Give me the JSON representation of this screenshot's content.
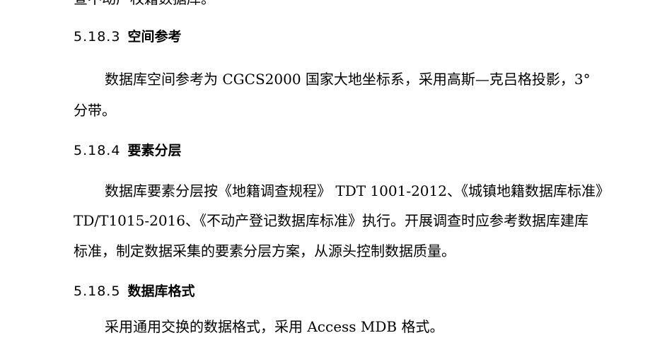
{
  "cut_line": "查不动产权籍数据库。",
  "sections": [
    {
      "number": "5.18.3",
      "title": "空间参考",
      "lines": [
        "数据库空间参考为 CGCS2000 国家大地坐标系，采用高斯—克吕格投影，3°",
        "分带。"
      ]
    },
    {
      "number": "5.18.4",
      "title": "要素分层",
      "lines": [
        "数据库要素分层按《地籍调查规程》 TDT 1001-2012、《城镇地籍数据库标准》",
        "TD/T1015-2016、《不动产登记数据库标准》执行。开展调查时应参考数据库建库",
        "标准，制定数据采集的要素分层方案，从源头控制数据质量。"
      ]
    },
    {
      "number": "5.18.5",
      "title": "数据库格式",
      "lines": [
        "采用通用交换的数据格式，采用 Access MDB 格式。"
      ]
    }
  ]
}
